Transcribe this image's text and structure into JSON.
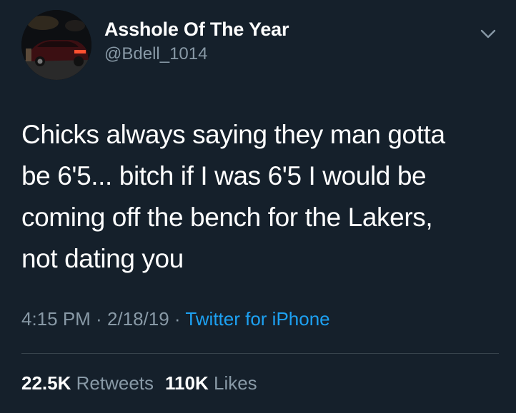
{
  "user": {
    "display_name": "Asshole Of The Year",
    "handle": "@Bdell_1014"
  },
  "tweet": {
    "lines": [
      "Chicks always saying they man gotta",
      "be 6'5... bitch if I was 6'5 I would be",
      "coming off the bench for the Lakers,",
      "not dating you"
    ]
  },
  "meta": {
    "time": "4:15 PM",
    "sep1": " · ",
    "date": "2/18/19",
    "sep2": " · ",
    "source": "Twitter for iPhone"
  },
  "stats": {
    "retweets_count": "22.5K",
    "retweets_label": "Retweets",
    "likes_count": "110K",
    "likes_label": "Likes"
  },
  "icons": {
    "more": "chevron-down-icon"
  },
  "colors": {
    "background": "#15202b",
    "text": "#ffffff",
    "secondary": "#8899a6",
    "link": "#1da1f2",
    "divider": "#38444d"
  }
}
